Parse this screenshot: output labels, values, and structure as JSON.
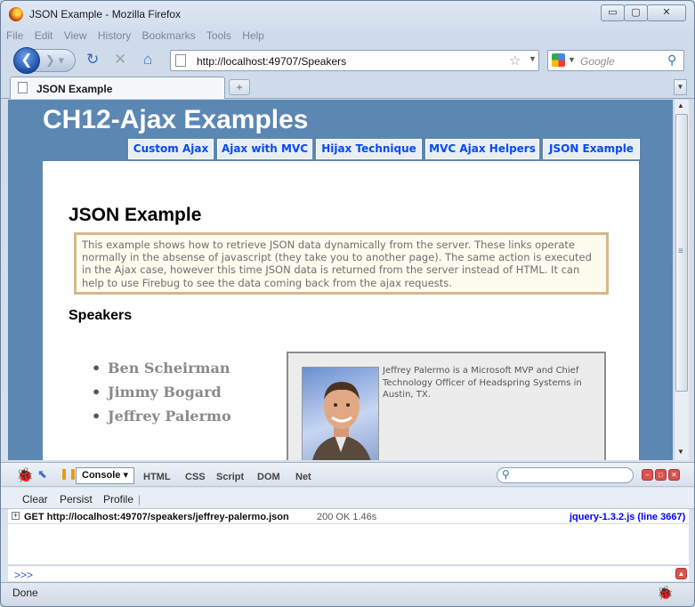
{
  "window": {
    "title": "JSON Example - Mozilla Firefox",
    "controls": {
      "minimize": "▭",
      "maximize": "▢",
      "close": "✕"
    }
  },
  "menubar": [
    "File",
    "Edit",
    "View",
    "History",
    "Bookmarks",
    "Tools",
    "Help"
  ],
  "navbar": {
    "url": "http://localhost:49707/Speakers",
    "search_placeholder": "Google",
    "icons": [
      "back-icon",
      "forward-icon",
      "reload-icon",
      "stop-icon",
      "home-icon",
      "bookmark-star-icon",
      "search-icon"
    ]
  },
  "tabs": [
    {
      "label": "JSON Example",
      "active": true
    }
  ],
  "page": {
    "site_title": "CH12-Ajax Examples",
    "menu": [
      "Custom Ajax",
      "Ajax with MVC",
      "Hijax Technique",
      "MVC Ajax Helpers",
      "JSON Example"
    ],
    "heading": "JSON Example",
    "note": "This example shows how to retrieve JSON data dynamically from the server. These links operate normally in the absense of javascript (they take you to another page). The same action is executed in the Ajax case, however this time JSON data is returned from the server instead of HTML. It can help to use Firebug to see the data coming back from the ajax requests.",
    "subheading": "Speakers",
    "speakers": [
      "Ben Scheirman",
      "Jimmy Bogard",
      "Jeffrey Palermo"
    ],
    "speaker_bio": "Jeffrey Palermo is a Microsoft MVP and Chief Technology Officer of Headspring Systems in Austin, TX."
  },
  "firebug": {
    "console_label": "Console ▾",
    "panels": [
      "HTML",
      "CSS",
      "Script",
      "DOM",
      "Net"
    ],
    "subtoolbar": [
      "Clear",
      "Persist",
      "Profile"
    ],
    "log": {
      "request": "GET http://localhost:49707/speakers/jeffrey-palermo.json",
      "status": "200 OK 1.46s",
      "source": "jquery-1.3.2.js (line 3667)"
    },
    "prompt": ">>>"
  },
  "status": "Done",
  "colors": {
    "page_bg": "#5c87b2",
    "menu_link": "#034af3",
    "note_border": "#d4b98b"
  }
}
